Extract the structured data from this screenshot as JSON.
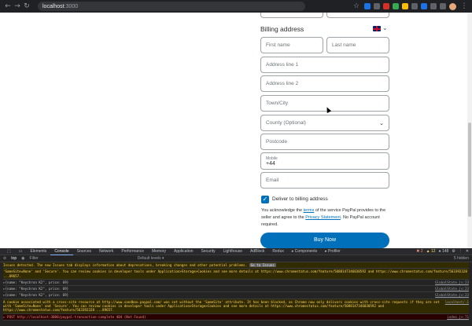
{
  "browser": {
    "url_host": "localhost",
    "url_port": ":3000",
    "back_icon": "arrow-left-icon",
    "forward_icon": "arrow-right-icon",
    "reload_icon": "reload-icon"
  },
  "billing": {
    "title": "Billing address",
    "country_flag": "uk-flag-icon",
    "first_name_placeholder": "First name",
    "last_name_placeholder": "Last name",
    "address1_placeholder": "Address line 1",
    "address2_placeholder": "Address line 2",
    "town_placeholder": "Town/City",
    "county_placeholder": "County (Optional)",
    "postcode_placeholder": "Postcode",
    "mobile_label": "Mobile",
    "mobile_value": "+44",
    "email_placeholder": "Email",
    "deliver_label": "Deliver to billing address",
    "deliver_checked": true,
    "legal_before": "You acknowledge the ",
    "legal_terms": "terms",
    "legal_mid": " of the service PayPal provides to the seller and agree to the ",
    "legal_privacy": "Privacy Statement",
    "legal_after": ". No PayPal account required.",
    "buy_button": "Buy Now",
    "accent_color": "#0070ba"
  },
  "devtools": {
    "tabs": [
      "Elements",
      "Console",
      "Sources",
      "Network",
      "Performance",
      "Memory",
      "Application",
      "Security",
      "Lighthouse",
      "AdBlock",
      "Redux",
      "▸ Components",
      "▸ Profiler"
    ],
    "active_tab": "Console",
    "error_count": "2",
    "warn_count": "12",
    "info_count": "148",
    "context": "top",
    "filter_placeholder": "Filter",
    "levels": "Default levels ▾",
    "hidden": "5 hidden",
    "issues_banner": "Issues detected. The new Issues tab displays information about deprecations, breaking changes and other potential problems.",
    "goto_issues": "Go to Issues",
    "logs": [
      {
        "kind": "warn",
        "msg": "'SameSite=None' and 'Secure'. You can review cookies in developer tools under Application>Storage>Cookies and see more details at https://www.chromestatus.com/feature/5088147346030592 and https://www.chromestatus.com/feature/563392328 ...89657.",
        "src": ""
      },
      {
        "kind": "info",
        "msg": "▸{name: \"Keychron K2\", price: 69}",
        "src": "GlobalState.js:23"
      },
      {
        "kind": "info",
        "msg": "▸{name: \"Keychron K2\", price: 69}",
        "src": "GlobalState.js:23"
      },
      {
        "kind": "info",
        "msg": "▸{name: \"Keychron K2\", price: 69}",
        "src": "GlobalState.js:23"
      },
      {
        "kind": "warn",
        "msg": "A cookie associated with a cross-site resource at http://www.sandbox.paypal.com/ was set without the 'SameSite' attribute. It has been blocked, as Chrome now only delivers cookies with cross-site requests if they are set with 'SameSite=None' and 'Secure'. You can review cookies in developer tools under Application>Storage>Cookies and see more details at https://www.chromestatus.com/feature/5088147346030592 and https://www.chromestatus.com/feature/563392328 ...89657.",
        "src": "localhost/:1"
      },
      {
        "kind": "error",
        "msg": "▸ POST http://localhost:3000/paypal-transaction-complete 404 (Not Found)",
        "src": "index.js:71"
      }
    ]
  }
}
